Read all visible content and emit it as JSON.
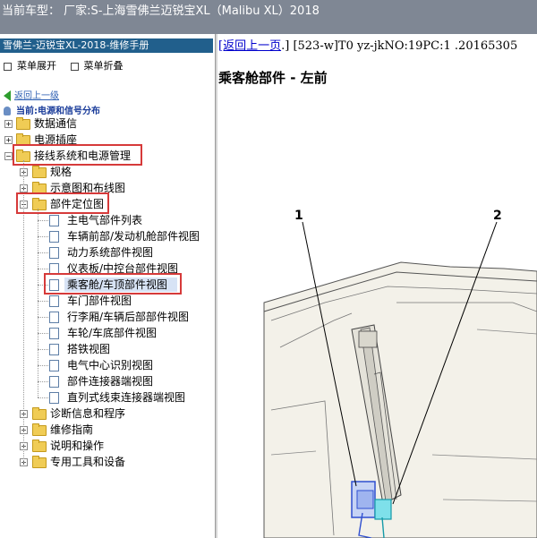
{
  "window": {
    "title": "当前车型：  厂家:S-上海雪佛兰迈锐宝XL（Malibu XL）2018"
  },
  "sidebar": {
    "manual_title": "雪佛兰-迈锐宝XL-2018-维修手册",
    "expand_all": "菜单展开",
    "collapse_all": "菜单折叠",
    "back": "返回上一级",
    "current": "当前:电源和信号分布",
    "tree": [
      {
        "label": "数据通信",
        "type": "folder",
        "state": "collapsed"
      },
      {
        "label": "电源插座",
        "type": "folder",
        "state": "collapsed"
      },
      {
        "label": "接线系统和电源管理",
        "type": "folder",
        "state": "expanded",
        "highlighted": true
      },
      {
        "label": "规格",
        "type": "folder",
        "state": "collapsed"
      },
      {
        "label": "示意图和布线图",
        "type": "folder",
        "state": "collapsed"
      },
      {
        "label": "部件定位图",
        "type": "folder",
        "state": "expanded",
        "highlighted": true
      },
      {
        "label": "主电气部件列表",
        "type": "doc"
      },
      {
        "label": "车辆前部/发动机舱部件视图",
        "type": "doc"
      },
      {
        "label": "动力系统部件视图",
        "type": "doc"
      },
      {
        "label": "仪表板/中控台部件视图",
        "type": "doc"
      },
      {
        "label": "乘客舱/车顶部件视图",
        "type": "doc",
        "selected": true,
        "highlighted": true
      },
      {
        "label": "车门部件视图",
        "type": "doc"
      },
      {
        "label": "行李厢/车辆后部部件视图",
        "type": "doc"
      },
      {
        "label": "车轮/车底部件视图",
        "type": "doc"
      },
      {
        "label": "搭铁视图",
        "type": "doc"
      },
      {
        "label": "电气中心识别视图",
        "type": "doc"
      },
      {
        "label": "部件连接器端视图",
        "type": "doc"
      },
      {
        "label": "直列式线束连接器端视图",
        "type": "doc"
      },
      {
        "label": "诊断信息和程序",
        "type": "folder",
        "state": "collapsed"
      },
      {
        "label": "维修指南",
        "type": "folder",
        "state": "collapsed"
      },
      {
        "label": "说明和操作",
        "type": "folder",
        "state": "collapsed"
      },
      {
        "label": "专用工具和设备",
        "type": "folder",
        "state": "collapsed"
      }
    ]
  },
  "document": {
    "back_link": "[返回上一页",
    "back_suffix": ".]",
    "meta": "[523-w]T0 yz-jkNO:19PC:1 .20165305",
    "title": "乘客舱部件 - 左前",
    "callouts": [
      "1",
      "2"
    ]
  },
  "colors": {
    "title_bar": "#7f8794",
    "manual_header": "#215f8c",
    "highlight": "#d63a3a",
    "link": "#0000cc"
  },
  "icons": {
    "folder": "folder-icon",
    "document": "document-icon",
    "back": "back-arrow-icon",
    "current": "location-pin-icon"
  }
}
